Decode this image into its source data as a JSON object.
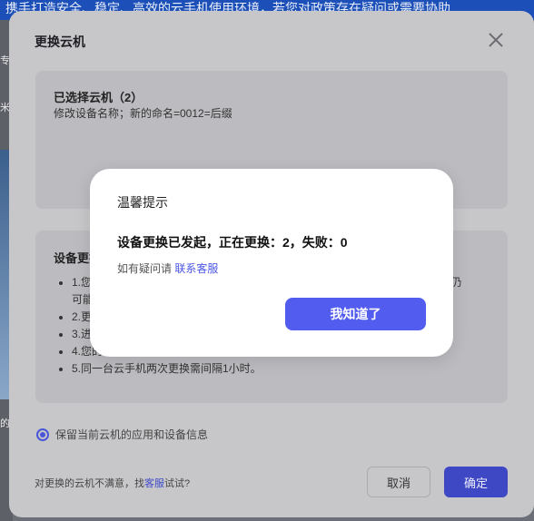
{
  "background": {
    "banner_text": "携手打造安全、稳定、高效的云手机使用环境，若您对政策存在疑问或需要协助",
    "left_fragments": [
      "专",
      "米",
      "的"
    ]
  },
  "modal": {
    "title": "更换云机",
    "selected": {
      "title": "已选择云机（2）",
      "description": "修改设备名称；新的命名=0012=后缀"
    },
    "notes": {
      "title": "设备更换",
      "items": [
        "1.您",
        "可能",
        "2.更",
        "3.进",
        "4.您的",
        "5.同一台云手机两次更换需间隔1小时。"
      ],
      "item1_tail": "中,但仍"
    },
    "option_label": "保留当前云机的应用和设备信息",
    "footer_hint_prefix": "对更换的云机不满意，找",
    "footer_hint_link": "客服",
    "footer_hint_suffix": "试试?",
    "cancel_label": "取消",
    "confirm_label": "确定"
  },
  "dialog": {
    "title": "温馨提示",
    "message": "设备更换已发起，正在更换：2，失败：0",
    "help_prefix": "如有疑问请",
    "help_link": "联系客服",
    "ok_label": "我知道了"
  },
  "colors": {
    "accent": "#525df0",
    "overlay": "#c7c7ca"
  }
}
